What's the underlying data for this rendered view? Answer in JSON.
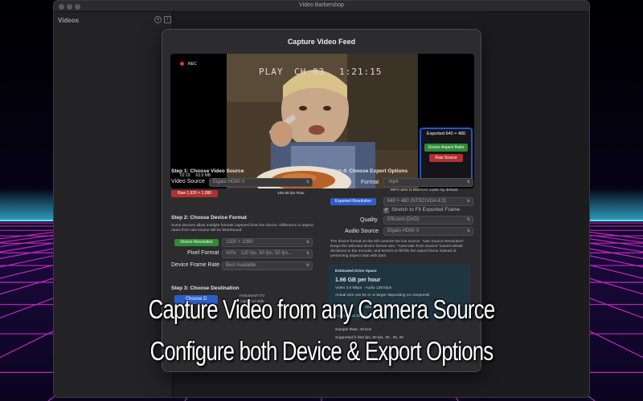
{
  "window": {
    "title": "Video Barbershop"
  },
  "sidebar": {
    "title": "Videos",
    "add_icon": "plus-circle-icon",
    "import_icon": "import-icon"
  },
  "sheet": {
    "title": "Capture Video Feed",
    "preview": {
      "rec_label": "REC",
      "osd_play": "PLAY",
      "osd_channel": "CH 03",
      "osd_time": "1:21:15",
      "duration": "02:19",
      "size": "63.9 MB",
      "overlay_title": "Exported 640 × 480",
      "overlay_device_aspect": "Device Aspect Ratio",
      "overlay_raw_source": "Raw Source"
    },
    "step1": {
      "heading": "Step 1: Choose Video Source",
      "video_source_label": "Video Source",
      "video_source_value": "Elgato HD60 X",
      "raw_badge": "Raw 1,920 × 1,080",
      "raw_fps": "105.88 fps Raw"
    },
    "step2": {
      "heading": "Step 2: Choose Device Format",
      "description": "Some devices allow multiple formats captured from the device. Difference in aspect ratios from raw source will be letterboxed.",
      "device_resolution_badge": "Device Resolution",
      "device_resolution_value": "1920 × 1080",
      "pixel_format_label": "Pixel Format",
      "pixel_format_value": "420v · 120 fps, 60 fps, 50 fps...",
      "frame_rate_label": "Device Frame Rate",
      "frame_rate_value": "Best Available"
    },
    "step3": {
      "heading": "Step 3: Choose Destination",
      "choose_button": "Choose D",
      "path_line1": "/Volumes/T7/V",
      "path_line2": "Captured Vide"
    },
    "step4": {
      "heading": "Step 4: Choose Export Options",
      "format_label": "Format",
      "format_value": ".mp4",
      "format_note": "MP4 uses H.264/AAC codec by default.",
      "exported_resolution_badge": "Exported Resolution",
      "exported_resolution_value": "640 × 480 (NTSC/VGA 4:3)",
      "stretch_label": "Stretch to Fit Exported Frame",
      "quality_label": "Quality",
      "quality_value": "Efficient (DVD)",
      "audio_source_label": "Audio Source",
      "audio_source_value": "Elgato HD60 X",
      "explanation": "The device format on the left controls the live source. \"Use Source Resolution\" keeps the selected device format size, \"Automatic from Source\" leaves bitrate decisions to the encoder, and stretch-to-fill fills the export frame instead of preserving aspect ratio with bars."
    },
    "estimate": {
      "title": "Estimated Drive Space",
      "rate": "1.66 GB per hour",
      "bitrates": "Video 3.6 Mbps · Audio 128 kbps",
      "note": "Actual size can be  er or larger depending on compressi",
      "line_video": "556",
      "line_audio": "Audio Bitrat  28 kbps",
      "sample_rate": "Sample Rate: 48 kHz",
      "supported": "Supported fr  lists    fps, 60 fps, 30  , 25, 26"
    }
  },
  "captions": {
    "line1": "Capture Video from any Camera Source",
    "line2": "Configure both Device & Export Options"
  },
  "colors": {
    "raw_badge": "#b03030",
    "device_badge": "#2e8b35",
    "exported_badge": "#2d5ec8",
    "overlay_border": "#2456c8",
    "grid": "#d42ad0",
    "horizon": "#2ad2ff"
  }
}
